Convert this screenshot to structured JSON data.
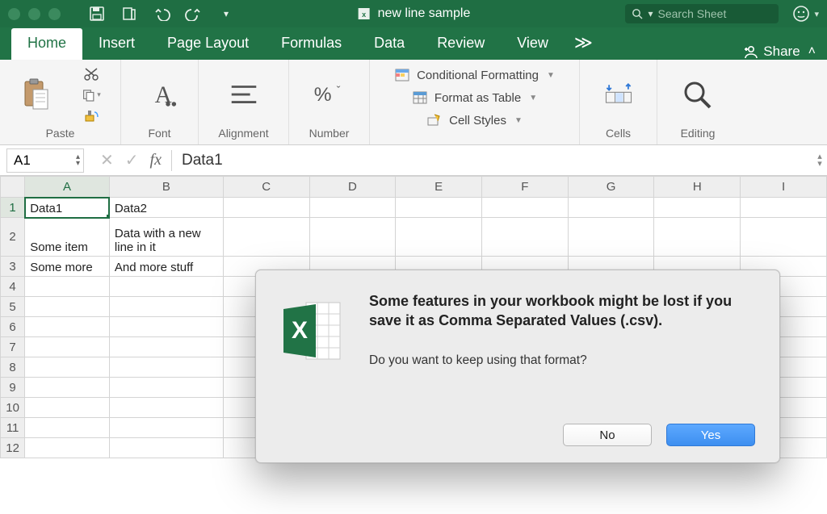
{
  "title": "new line sample",
  "search_placeholder": "Search Sheet",
  "tabs": [
    "Home",
    "Insert",
    "Page Layout",
    "Formulas",
    "Data",
    "Review",
    "View"
  ],
  "active_tab": 0,
  "overflow_glyph": "≫",
  "share_label": "Share",
  "ribbon": {
    "paste": "Paste",
    "font": "Font",
    "alignment": "Alignment",
    "number": "Number",
    "cells": "Cells",
    "editing": "Editing",
    "styles": {
      "cond": "Conditional Formatting",
      "table": "Format as Table",
      "cell": "Cell Styles"
    }
  },
  "name_box": "A1",
  "fx_label": "fx",
  "formula_value": "Data1",
  "columns": [
    "A",
    "B",
    "C",
    "D",
    "E",
    "F",
    "G",
    "H",
    "I"
  ],
  "rows": 12,
  "cells": {
    "A1": "Data1",
    "B1": "Data2",
    "A2": "Some item",
    "B2": "Data with a new line in it",
    "A3": "Some more",
    "B3": "And more stuff"
  },
  "selected": "A1",
  "dialog": {
    "headline": "Some features in your workbook might be lost if you save it as Comma Separated Values (.csv).",
    "subtext": "Do you want to keep using that format?",
    "no": "No",
    "yes": "Yes"
  }
}
